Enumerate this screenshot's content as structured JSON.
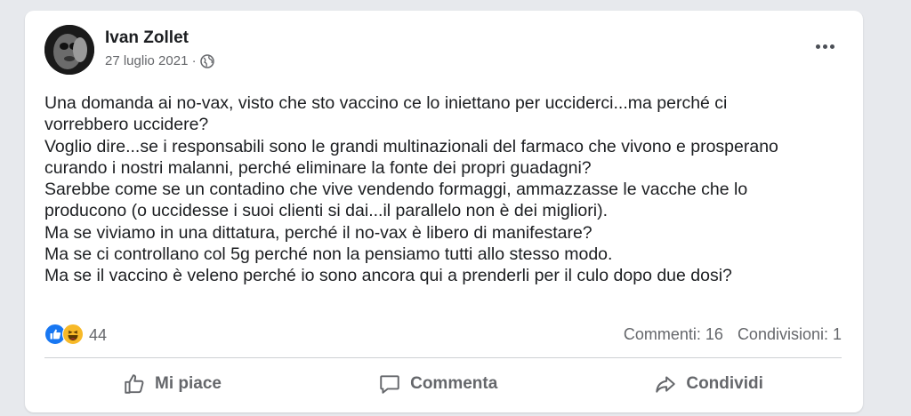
{
  "post": {
    "author": "Ivan Zollet",
    "date": "27 luglio 2021 ·",
    "privacy_icon": "globe-icon",
    "more_icon": "more-options-icon",
    "text_lines": [
      "Una domanda ai no-vax, visto che sto vaccino ce lo iniettano per ucciderci...ma perché ci",
      "vorrebbero uccidere?",
      "Voglio dire...se i responsabili sono le grandi multinazionali del farmaco che vivono e prosperano",
      "curando i nostri malanni, perché eliminare la fonte dei propri guadagni?",
      "Sarebbe come se un contadino che vive vendendo formaggi, ammazzasse le vacche che lo",
      "producono (o uccidesse i suoi clienti si dai...il parallelo non è dei migliori).",
      "Ma se viviamo in una dittatura, perché il no-vax è  libero di manifestare?",
      "Ma se ci controllano col 5g perché non la pensiamo tutti allo stesso modo.",
      "Ma se il vaccino è veleno perché io sono ancora qui a prenderli per il culo dopo due dosi?"
    ]
  },
  "reactions": {
    "icons": [
      "like-reaction-icon",
      "haha-reaction-icon"
    ],
    "count": "44"
  },
  "stats": {
    "comments": "Commenti: 16",
    "shares": "Condivisioni: 1"
  },
  "actions": {
    "like": "Mi piace",
    "comment": "Commenta",
    "share": "Condividi"
  },
  "colors": {
    "like_blue": "#1877f2",
    "haha_yellow": "#f7b928",
    "secondary_text": "#65676b"
  }
}
